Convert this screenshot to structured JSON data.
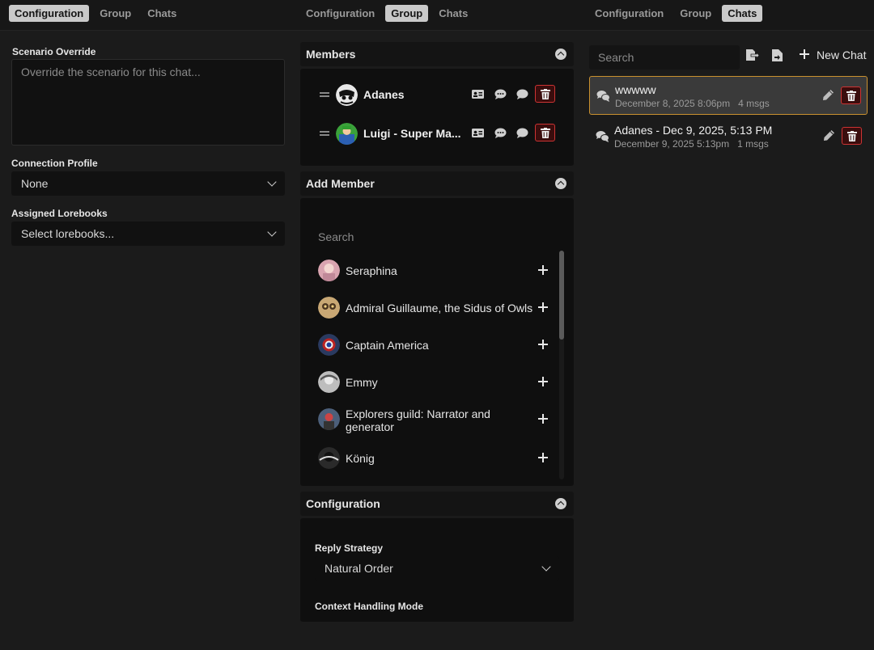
{
  "tabs": {
    "col1": [
      {
        "label": "Configuration",
        "active": true
      },
      {
        "label": "Group",
        "active": false
      },
      {
        "label": "Chats",
        "active": false
      }
    ],
    "col2": [
      {
        "label": "Configuration",
        "active": false
      },
      {
        "label": "Group",
        "active": true
      },
      {
        "label": "Chats",
        "active": false
      }
    ],
    "col3": [
      {
        "label": "Configuration",
        "active": false
      },
      {
        "label": "Group",
        "active": false
      },
      {
        "label": "Chats",
        "active": true
      }
    ]
  },
  "config": {
    "scenario_label": "Scenario Override",
    "scenario_placeholder": "Override the scenario for this chat...",
    "connection_label": "Connection Profile",
    "connection_value": "None",
    "lorebooks_label": "Assigned Lorebooks",
    "lorebooks_value": "Select lorebooks..."
  },
  "members": {
    "title": "Members",
    "items": [
      {
        "name": "Adanes",
        "avatar": "avatar-adanes"
      },
      {
        "name": "Luigi - Super Ma...",
        "avatar": "avatar-luigi"
      }
    ]
  },
  "add_member": {
    "title": "Add Member",
    "search_placeholder": "Search",
    "candidates": [
      {
        "name": "Seraphina"
      },
      {
        "name": "Admiral Guillaume, the Sidus of Owls"
      },
      {
        "name": "Captain America"
      },
      {
        "name": "Emmy"
      },
      {
        "name": "Explorers guild: Narrator and generator"
      },
      {
        "name": "König"
      }
    ]
  },
  "group_config": {
    "title": "Configuration",
    "reply_strategy_label": "Reply Strategy",
    "reply_strategy_value": "Natural Order",
    "context_mode_label": "Context Handling Mode"
  },
  "chats": {
    "search_placeholder": "Search",
    "new_chat_label": "New Chat",
    "items": [
      {
        "title": "wwwww",
        "date": "December 8, 2025 8:06pm",
        "count": "4 msgs",
        "active": true
      },
      {
        "title": "Adanes - Dec 9, 2025, 5:13 PM",
        "date": "December 9, 2025 5:13pm",
        "count": "1 msgs",
        "active": false
      }
    ]
  },
  "colors": {
    "accent_border": "#c9902f",
    "danger": "#cc3333",
    "background": "#1b1b1b"
  }
}
